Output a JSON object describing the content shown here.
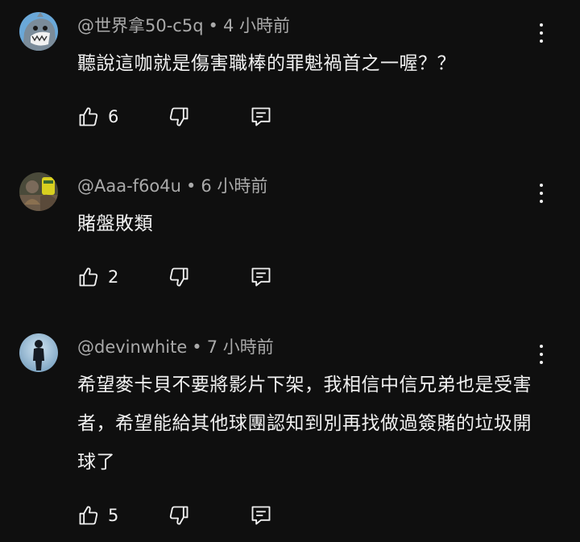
{
  "comments": [
    {
      "author": "@世界拿50-c5q",
      "separator": "•",
      "time": "4 小時前",
      "text": "聽說這咖就是傷害職棒的罪魁禍首之一喔？？",
      "likes": "6",
      "avatar": "shark-avatar-icon"
    },
    {
      "author": "@Aaa-f6o4u",
      "separator": "•",
      "time": "6 小時前",
      "text": "賭盤敗類",
      "likes": "2",
      "avatar": "photo-avatar-icon"
    },
    {
      "author": "@devinwhite",
      "separator": "•",
      "time": "7 小時前",
      "text": "希望麥卡貝不要將影片下架，我相信中信兄弟也是受害者，希望能給其他球團認知到別再找做過簽賭的垃圾開球了",
      "likes": "5",
      "avatar": "silhouette-avatar-icon"
    }
  ],
  "icons": {
    "like": "thumb-up-icon",
    "dislike": "thumb-down-icon",
    "reply": "reply-icon",
    "more": "more-vert-icon"
  },
  "colors": {
    "background": "#0f0f0f",
    "text": "#f1f1f1",
    "meta": "#aaaaaa"
  }
}
